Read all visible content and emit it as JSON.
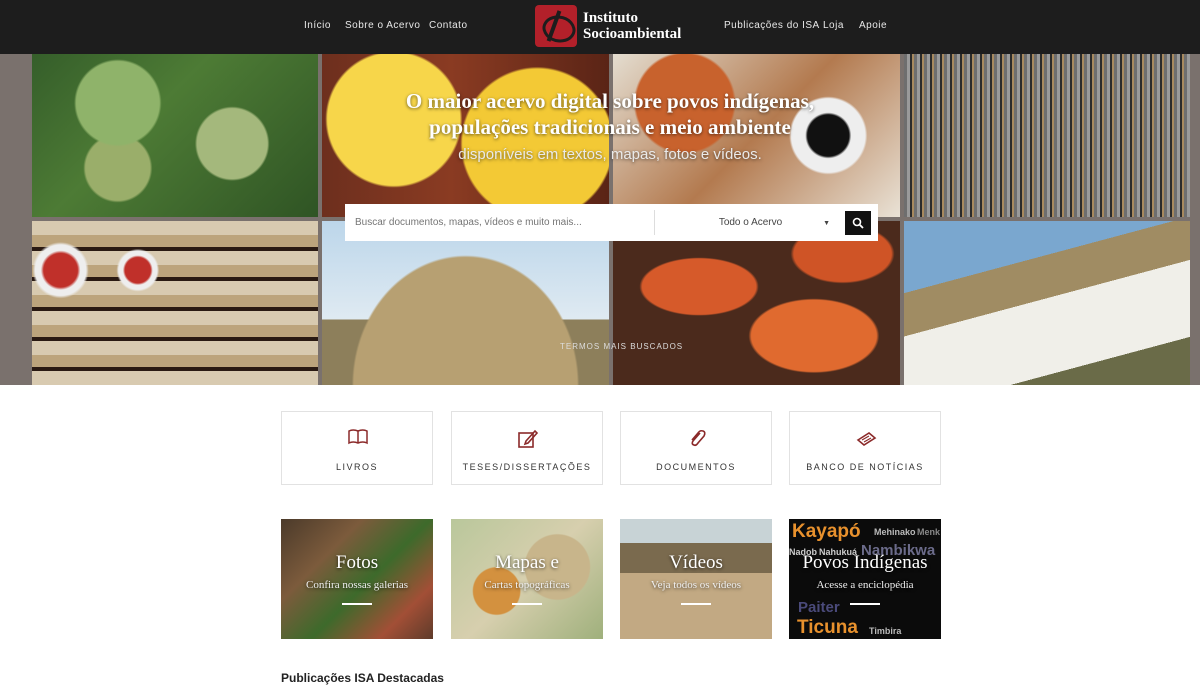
{
  "nav": {
    "left": [
      "Início",
      "Sobre o Acervo",
      "Contato"
    ],
    "right": [
      "Publicações do ISA",
      "Loja",
      "Apoie"
    ],
    "logo_line1": "Instituto",
    "logo_line2": "Socioambiental"
  },
  "hero": {
    "title": "O maior acervo digital sobre povos indígenas, populações tradicionais e meio ambiente",
    "subtitle": "disponíveis em textos, mapas, fotos e vídeos.",
    "search_placeholder": "Buscar documentos, mapas, vídeos e muito mais...",
    "select_value": "Todo o Acervo",
    "most_searched": "TERMOS MAIS BUSCADOS"
  },
  "categories": [
    "LIVROS",
    "TESES/DISSERTAÇÕES",
    "DOCUMENTOS",
    "BANCO DE NOTÍCIAS"
  ],
  "features": [
    {
      "title": "Fotos",
      "subtitle": "Confira nossas galerias"
    },
    {
      "title": "Mapas e",
      "subtitle": "Cartas topográficas"
    },
    {
      "title": "Vídeos",
      "subtitle": "Veja todos os vídeos"
    },
    {
      "title": "Povos Indígenas",
      "subtitle": "Acesse a enciclopédia"
    }
  ],
  "povos_words": [
    "Kayapó",
    "Mehinako",
    "Menk",
    "Nadob",
    "Nahukuá",
    "Nambikwa",
    "Paiter",
    "Ticuna",
    "Timbira"
  ],
  "section_title": "Publicações ISA Destacadas"
}
